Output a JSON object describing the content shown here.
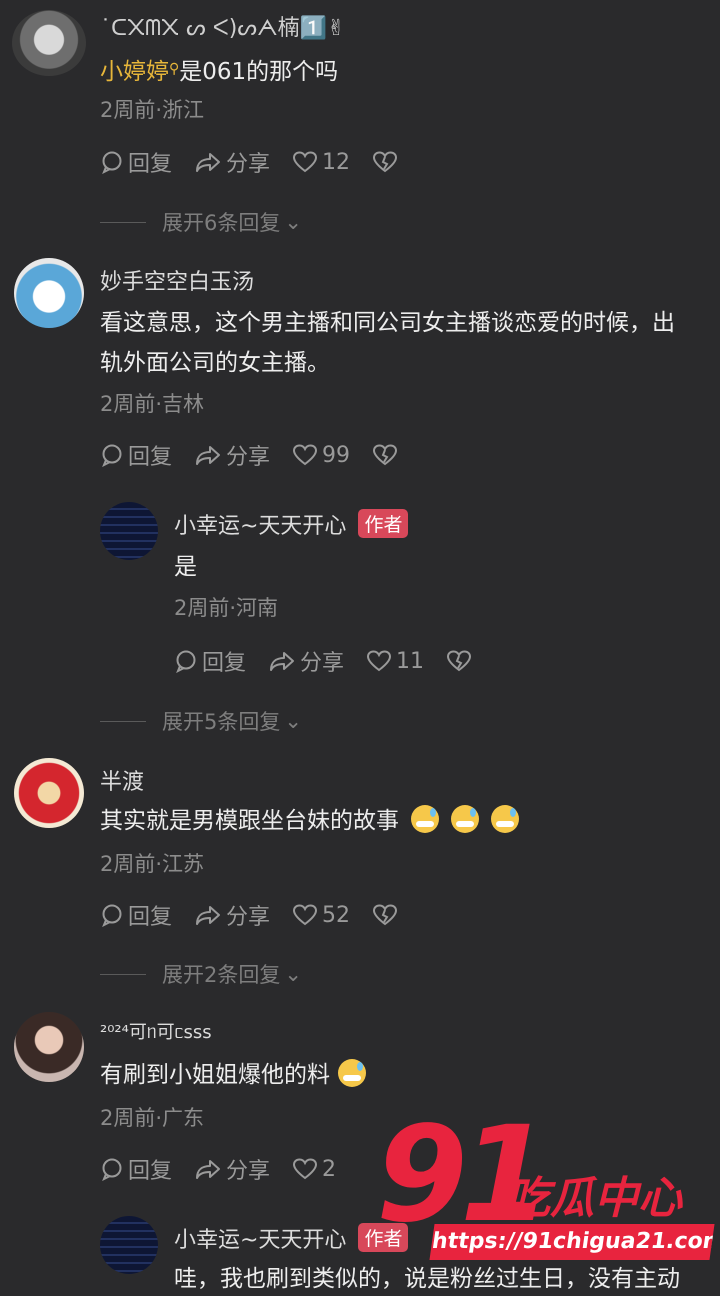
{
  "comments": [
    {
      "name": "˙ᑕ᙭ᗰ᙭ ᔕ ᐸ)ᔕᗅ楠1️⃣✌",
      "mention": "小婷婷",
      "text": "是061的那个吗",
      "meta": "2周前·浙江",
      "reply": "回复",
      "share": "分享",
      "likes": "12"
    },
    {
      "name": "妙手空空白玉汤",
      "text_line1": "看这意思，这个男主播和同公司女主播谈恋爱的时候，出",
      "text_line2": "轨外面公司的女主播。",
      "meta": "2周前·吉林",
      "reply": "回复",
      "share": "分享",
      "likes": "99"
    },
    {
      "name": "小幸运~天天开心",
      "badge": "作者",
      "text": "是",
      "meta": "2周前·河南",
      "reply": "回复",
      "share": "分享",
      "likes": "11"
    },
    {
      "name": "半渡",
      "text": "其实就是男模跟坐台妹的故事",
      "meta": "2周前·江苏",
      "reply": "回复",
      "share": "分享",
      "likes": "52"
    },
    {
      "name": "²⁰²⁴可ᥒ可ᥴsss",
      "text": "有刷到小姐姐爆他的料",
      "meta": "2周前·广东",
      "reply": "回复",
      "share": "分享",
      "likes": "2"
    },
    {
      "name": "小幸运~天天开心",
      "badge": "作者",
      "text": "哇，我也刷到类似的，说是粉丝过生日，没有主动"
    }
  ],
  "expand": [
    "展开6条回复",
    "展开5条回复",
    "展开2条回复"
  ],
  "watermark": {
    "big": "91",
    "cn": "吃瓜中心",
    "url": "https://91chigua21.com",
    "color": "#e8243e"
  }
}
